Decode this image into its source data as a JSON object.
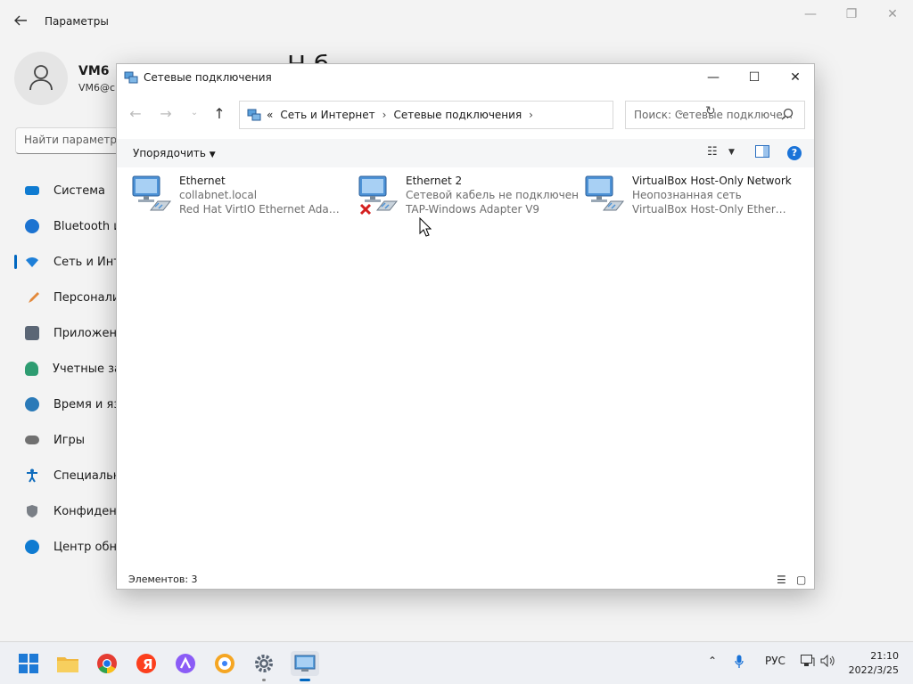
{
  "settings": {
    "title": "Параметры",
    "user_name": "VM6",
    "user_email": "VM6@c",
    "page_heading": "Н б",
    "search_placeholder": "Найти параметр",
    "nav": [
      {
        "label": "Система",
        "icon": "monitor-icon",
        "color": "#0f7bd1"
      },
      {
        "label": "Bluetooth и",
        "icon": "bluetooth-icon",
        "color": "#1c73d1"
      },
      {
        "label": "Сеть и Инт",
        "icon": "wifi-icon",
        "color": "#1d7fd8"
      },
      {
        "label": "Персонали",
        "icon": "brush-icon",
        "color": "#e3893b"
      },
      {
        "label": "Приложен",
        "icon": "apps-icon",
        "color": "#5b6675"
      },
      {
        "label": "Учетные за",
        "icon": "person-icon",
        "color": "#2e9c71"
      },
      {
        "label": "Время и яз",
        "icon": "clock-globe-icon",
        "color": "#2a7ab8"
      },
      {
        "label": "Игры",
        "icon": "gamepad-icon",
        "color": "#707070"
      },
      {
        "label": "Специальн",
        "icon": "accessibility-icon",
        "color": "#0f6cbd"
      },
      {
        "label": "Конфиден",
        "icon": "shield-icon",
        "color": "#7a7f86"
      },
      {
        "label": "Центр обн",
        "icon": "update-icon",
        "color": "#0f7bd1"
      }
    ]
  },
  "window": {
    "title": "Сетевые подключения",
    "address": {
      "prefix": "«",
      "crumbs": [
        "Сеть и Интернет",
        "Сетевые подключения"
      ]
    },
    "search_placeholder": "Поиск: Сетевые подключе...",
    "organize_label": "Упорядочить",
    "status_text": "Элементов: 3",
    "connections": [
      {
        "name": "Ethernet",
        "status": "collabnet.local",
        "device": "Red Hat VirtIO Ethernet Adapter",
        "disconnected": false
      },
      {
        "name": "Ethernet 2",
        "status": "Сетевой кабель не подключен",
        "device": "TAP-Windows Adapter V9",
        "disconnected": true
      },
      {
        "name": "VirtualBox Host-Only Network",
        "status": "Неопознанная сеть",
        "device": "VirtualBox Host-Only Ethernet Ad...",
        "disconnected": false
      }
    ]
  },
  "taskbar": {
    "apps": [
      "windows-start-icon",
      "file-explorer-icon",
      "chrome-icon",
      "yandex-browser-icon",
      "alice-icon",
      "yandex-icon",
      "settings-gear-icon",
      "network-connections-icon"
    ],
    "language": "РУС",
    "time": "21:10",
    "date": "2022/3/25"
  },
  "colors": {
    "accent": "#0067c0",
    "help": "#1a73d8",
    "disconnected_x": "#d42020"
  }
}
